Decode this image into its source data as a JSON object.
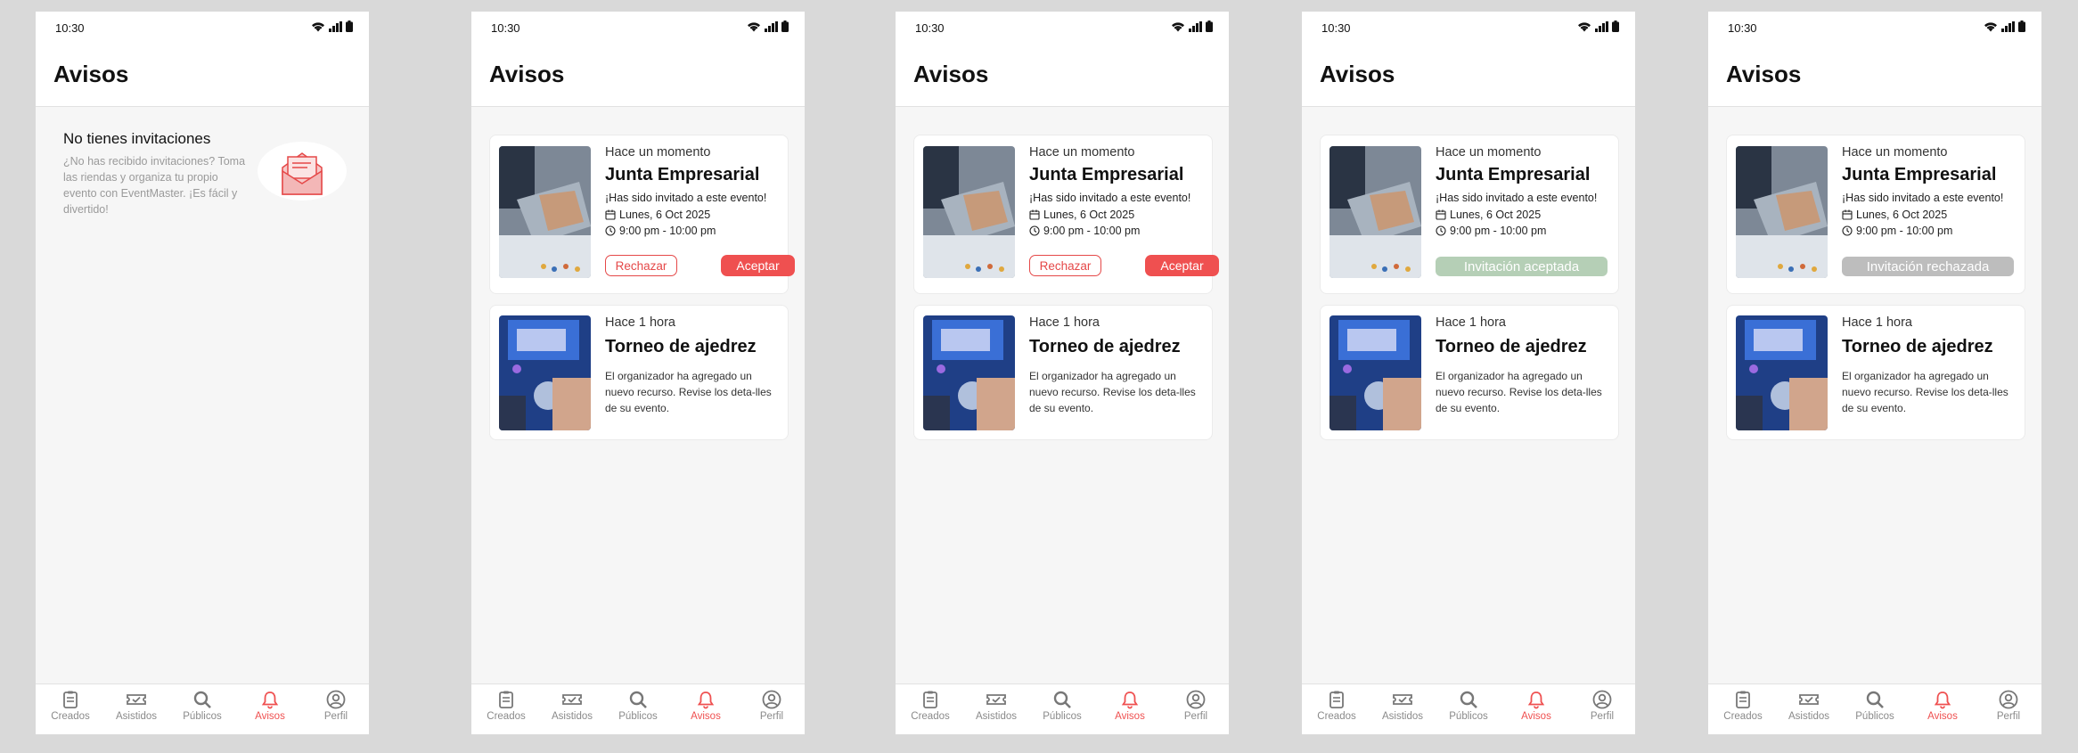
{
  "colors": {
    "accent": "#ef5050",
    "accepted": "#b5cfb6",
    "rejected": "#bdbdbd"
  },
  "status": {
    "time": "10:30"
  },
  "header": {
    "title": "Avisos"
  },
  "empty": {
    "title": "No tienes invitaciones",
    "text": "¿No has recibido invitaciones? Toma las riendas y organiza tu propio evento con EventMaster. ¡Es fácil y divertido!"
  },
  "invite": {
    "time": "Hace un momento",
    "title": "Junta Empresarial",
    "subtitle": "¡Has sido invitado a este evento!",
    "date": "Lunes, 6 Oct 2025",
    "hours": "9:00 pm - 10:00 pm",
    "reject_label": "Rechazar",
    "accept_label": "Aceptar",
    "accepted_label": "Invitación aceptada",
    "rejected_label": "Invitación rechazada"
  },
  "update": {
    "time": "Hace 1 hora",
    "title": "Torneo de ajedrez",
    "desc": "El organizador ha agregado un nuevo recurso. Revise los deta-lles de su evento."
  },
  "tabs": [
    "Creados",
    "Asistidos",
    "Públicos",
    "Avisos",
    "Perfil"
  ],
  "active_tab": "Avisos"
}
